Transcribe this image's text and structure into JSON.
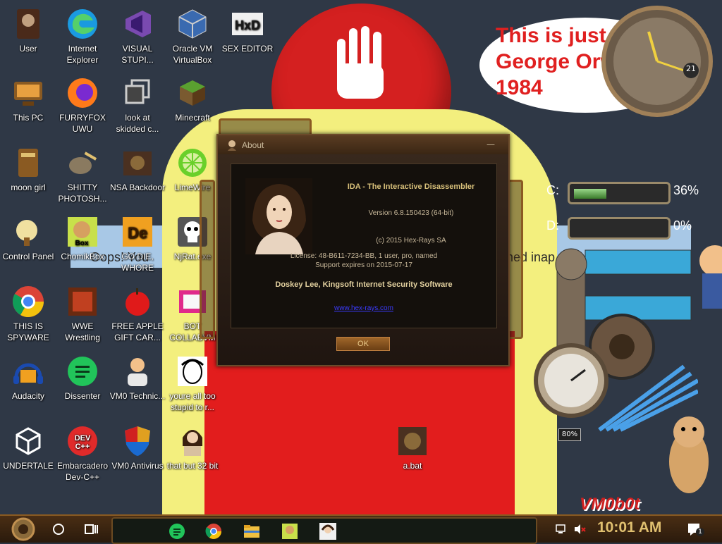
{
  "wallpaper": {
    "speech_bubble": "This is just like\nGeorge Orwell's\n1984",
    "error_text_left": "Oops! You",
    "error_text_right": "hed inap"
  },
  "desktop_icons": [
    {
      "id": "user",
      "label": "User",
      "icon": "user-folder-icon"
    },
    {
      "id": "this-pc",
      "label": "This PC",
      "icon": "computer-icon"
    },
    {
      "id": "moon-girl",
      "label": "moon girl",
      "icon": "folder-icon"
    },
    {
      "id": "control-panel",
      "label": "Control Panel",
      "icon": "control-panel-icon"
    },
    {
      "id": "this-is-spyware",
      "label": "THIS IS SPYWARE",
      "icon": "chrome-icon"
    },
    {
      "id": "audacity",
      "label": "Audacity",
      "icon": "audacity-icon"
    },
    {
      "id": "undertale",
      "label": "UNDERTALE",
      "icon": "unity-icon"
    },
    {
      "id": "internet-explorer",
      "label": "Internet Explorer",
      "icon": "edge-icon"
    },
    {
      "id": "furryfox",
      "label": "FURRYFOX UWU",
      "icon": "firefox-icon"
    },
    {
      "id": "shitty-photoshop",
      "label": "SHITTY PHOTOSH...",
      "icon": "gimp-icon"
    },
    {
      "id": "chomikbox",
      "label": "ChomikBox",
      "icon": "chomikbox-icon"
    },
    {
      "id": "wwe-wrestling",
      "label": "WWE Wrestling",
      "icon": "wrestling-icon"
    },
    {
      "id": "dissenter",
      "label": "Dissenter",
      "icon": "dissenter-icon"
    },
    {
      "id": "embarcadero",
      "label": "Embarcadero Dev-C++",
      "icon": "devcpp-icon"
    },
    {
      "id": "visual-studio",
      "label": "VISUAL STUPI...",
      "icon": "visual-studio-icon"
    },
    {
      "id": "look-at-skidded",
      "label": "look at skidded c...",
      "icon": "copy-icon"
    },
    {
      "id": "nsa-backdoor",
      "label": "NSA Backdoor",
      "icon": "folder-icon"
    },
    {
      "id": "go-die-whore",
      "label": "GO DIE, WHORE",
      "icon": "de-icon"
    },
    {
      "id": "free-apple",
      "label": "FREE APPLE GIFT CAR...",
      "icon": "apple-icon"
    },
    {
      "id": "vm0-technic",
      "label": "VM0 Technic...",
      "icon": "person-icon"
    },
    {
      "id": "vm0-antivirus",
      "label": "VM0 Antivirus",
      "icon": "shield-icon"
    },
    {
      "id": "oracle-vm",
      "label": "Oracle VM VirtualBox",
      "icon": "virtualbox-icon"
    },
    {
      "id": "minecraft",
      "label": "Minecraft",
      "icon": "minecraft-icon"
    },
    {
      "id": "limewire",
      "label": "LimeWire",
      "icon": "limewire-icon"
    },
    {
      "id": "njrat",
      "label": "NjRat.exe",
      "icon": "skull-icon"
    },
    {
      "id": "bot-collab",
      "label": "BOT COLLABVM",
      "icon": "bot-icon"
    },
    {
      "id": "youre-all-too",
      "label": "youre all too stupid to r...",
      "icon": "face-sketch-icon"
    },
    {
      "id": "that-but-32",
      "label": "that but 32 bit",
      "icon": "portrait-icon"
    },
    {
      "id": "sex-editor",
      "label": "SEX EDITOR",
      "icon": "hxd-icon"
    },
    {
      "id": "a-bat",
      "label": "a.bat",
      "icon": "folder-icon"
    }
  ],
  "about_dialog": {
    "title": "About",
    "app_title": "IDA - The Interactive Disassembler",
    "version": "Version 6.8.150423 (64-bit)",
    "copyright": "(c) 2015 Hex-Rays SA",
    "license": "License: 48-B611-7234-BB, 1 user, pro, named",
    "support": "Support expires on 2015-07-17",
    "owner": "Doskey Lee, Kingsoft Internet Security Software",
    "link": "www.hex-rays.com",
    "ok_label": "OK",
    "close_symbol": "—"
  },
  "drives": [
    {
      "letter": "C:",
      "percent_text": "36%",
      "fill": 0.36
    },
    {
      "letter": "D:",
      "percent_text": "0%",
      "fill": 0.0
    }
  ],
  "widgets": {
    "clock_day": "21",
    "gauge_readout": "80%",
    "brand": "VM0b0t"
  },
  "taskbar": {
    "time": "10:01 AM",
    "notification_count": "1",
    "pinned": [
      "dissenter-icon",
      "chrome-icon",
      "file-explorer-icon",
      "chomikbox-icon",
      "portrait-icon"
    ]
  },
  "colors": {
    "taskbar": "#3a2412",
    "dialog_bg": "#14100c",
    "accent_gold": "#e0c070",
    "drive_fill": "#5aa84a"
  }
}
